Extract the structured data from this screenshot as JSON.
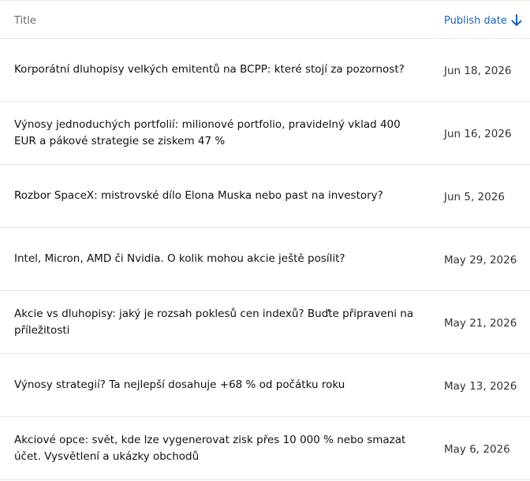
{
  "table": {
    "headers": {
      "title": "Title",
      "publish_date": "Publish date"
    },
    "sort": {
      "icon": "arrow-down-icon",
      "color": "#1a63b8"
    },
    "rows": [
      {
        "title": "Korporátní dluhopisy velkých emitentů na BCPP: které stojí za pozornost?",
        "date": "Jun 18, 2026"
      },
      {
        "title": "Výnosy jednoduchých portfolií: milionové portfolio, pravidelný vklad 400 EUR a pákové strategie se ziskem 47 %",
        "date": "Jun 16, 2026"
      },
      {
        "title": "Rozbor SpaceX: mistrovské dílo Elona Muska nebo past na investory?",
        "date": "Jun 5, 2026"
      },
      {
        "title": "Intel, Micron, AMD či Nvidia. O kolik mohou akcie ještě posílit?",
        "date": "May 29, 2026"
      },
      {
        "title": "Akcie vs dluhopisy: jaký je rozsah poklesů cen indexů? Buďte připraveni na příležitosti",
        "date": "May 21, 2026"
      },
      {
        "title": "Výnosy strategií? Ta nejlepší dosahuje +68 % od počátku roku",
        "date": "May 13, 2026"
      },
      {
        "title": "Akciové opce: svět, kde lze vygenerovat zisk přes 10 000 % nebo smazat účet. Vysvětlení a ukázky obchodů",
        "date": "May 6, 2026"
      }
    ]
  }
}
